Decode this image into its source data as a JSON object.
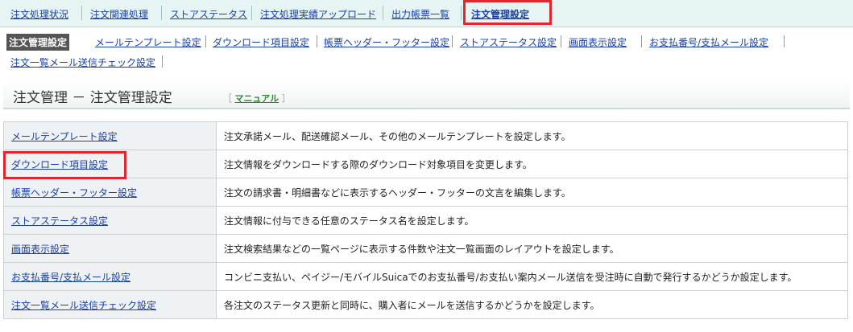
{
  "top_tabs": [
    {
      "label": "注文処理状況"
    },
    {
      "label": "注文関連処理"
    },
    {
      "label": "ストアステータス"
    },
    {
      "label": "注文処理実績アップロード"
    },
    {
      "label": "出力帳票一覧"
    },
    {
      "label": "注文管理設定"
    }
  ],
  "sub_menu": [
    {
      "label": "注文管理設定"
    },
    {
      "label": "メールテンプレート設定"
    },
    {
      "label": "ダウンロード項目設定"
    },
    {
      "label": "帳票ヘッダー・フッター設定"
    },
    {
      "label": "ストアステータス設定"
    },
    {
      "label": "画面表示設定"
    },
    {
      "label": "お支払番号/支払メール設定"
    },
    {
      "label": "注文一覧メール送信チェック設定"
    }
  ],
  "page": {
    "title": "注文管理 － 注文管理設定",
    "manual_label": "マニュアル"
  },
  "settings_rows": [
    {
      "name": "メールテンプレート設定",
      "description": "注文承諾メール、配送確認メール、その他のメールテンプレートを設定します。"
    },
    {
      "name": "ダウンロード項目設定",
      "description": "注文情報をダウンロードする際のダウンロード対象項目を変更します。"
    },
    {
      "name": "帳票ヘッダー・フッター設定",
      "description": "注文の請求書・明細書などに表示するヘッダー・フッターの文言を編集します。"
    },
    {
      "name": "ストアステータス設定",
      "description": "注文情報に付与できる任意のステータス名を設定します。"
    },
    {
      "name": "画面表示設定",
      "description": "注文検索結果などの一覧ページに表示する件数や注文一覧画面のレイアウトを設定します。"
    },
    {
      "name": "お支払番号/支払メール設定",
      "description": "コンビニ支払い、ペイジー/モバイルSuicaでのお支払番号/お支払い案内メール送信を受注時に自動で発行するかどうか設定します。"
    },
    {
      "name": "注文一覧メール送信チェック設定",
      "description": "各注文のステータス更新と同時に、購入者にメールを送信するかどうかを設定します。"
    }
  ],
  "colors": {
    "highlight": "#e0262e",
    "link": "#1a3fa8",
    "topbar_bg": "#e6f4f3"
  }
}
